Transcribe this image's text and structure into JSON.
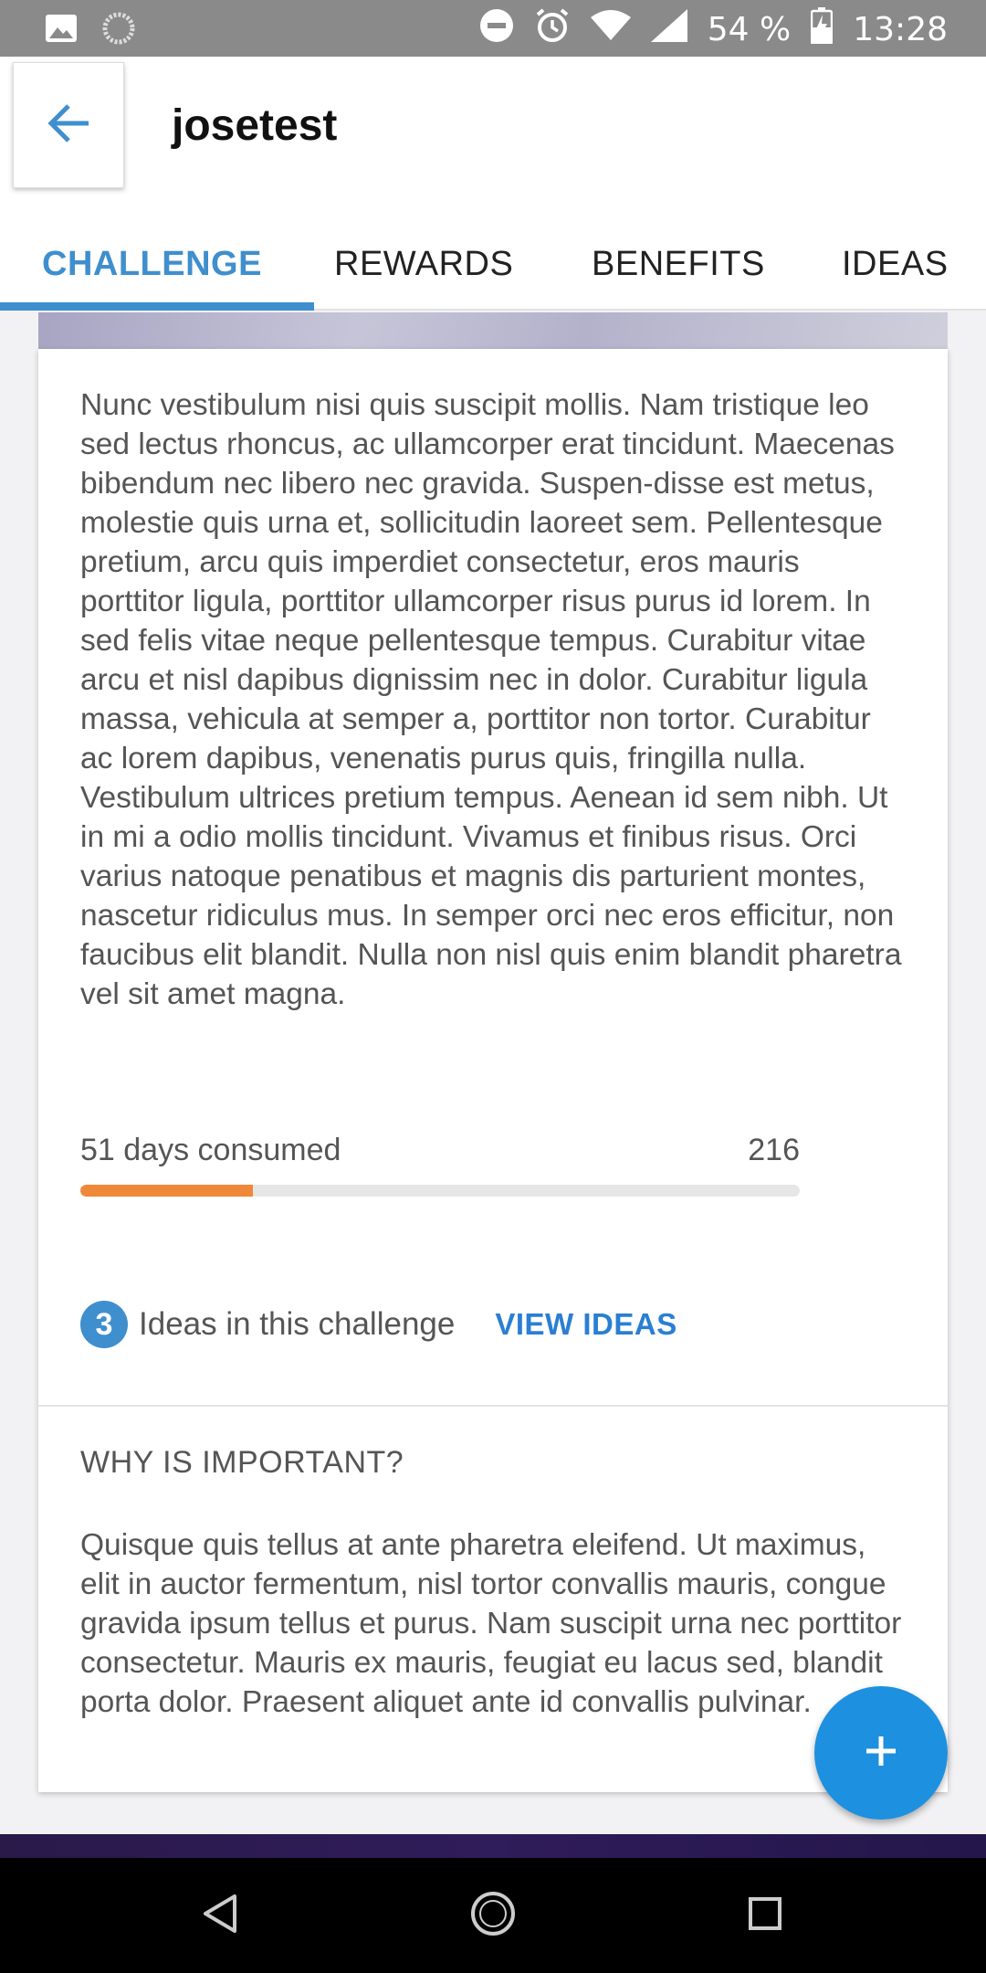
{
  "status_bar": {
    "battery": "54 %",
    "time": "13:28"
  },
  "app_bar": {
    "title": "josetest"
  },
  "tabs": [
    {
      "label": "CHALLENGE",
      "active": true
    },
    {
      "label": "REWARDS",
      "active": false
    },
    {
      "label": "BENEFITS",
      "active": false
    },
    {
      "label": "IDEAS",
      "active": false
    }
  ],
  "challenge": {
    "description": "Nunc vestibulum nisi quis suscipit mollis. Nam tristique leo sed lectus rhoncus, ac ullamcorper erat tincidunt. Maecenas bibendum nec libero nec gravida. Suspen-disse est metus, molestie quis urna et, sollicitudin laoreet sem. Pellentesque pretium, arcu quis imperdiet consectetur, eros mauris porttitor ligula, porttitor ullamcorper risus purus id lorem. In sed felis vitae neque pellentesque tempus. Curabitur vitae arcu et nisl dapibus dignissim nec in dolor. Curabitur ligula massa, vehicula at semper a, porttitor non tortor. Curabitur ac lorem dapibus, venenatis purus quis, fringilla nulla. Vestibulum ultrices pretium tempus. Aenean id sem nibh. Ut in mi a odio mollis tincidunt. Vivamus et finibus risus. Orci varius natoque penatibus et magnis dis parturient montes, nascetur ridiculus mus. In semper orci nec eros efficitur, non faucibus elit blandit. Nulla non nisl quis enim blandit pharetra vel sit amet magna.",
    "progress_label": "51 days consumed",
    "progress_total": "216",
    "progress_fraction": 0.24,
    "ideas_count": "3",
    "ideas_text": "Ideas in this challenge",
    "view_ideas_label": "VIEW IDEAS",
    "why_title": "WHY IS IMPORTANT?",
    "why_text": "Quisque quis tellus at ante pharetra eleifend. Ut maximus, elit in auctor fermentum, nisl tortor convallis mauris, congue gravida ipsum tellus et purus. Nam suscipit urna nec porttitor consectetur. Mauris ex mauris, feugiat eu lacus sed, blandit porta dolor. Praesent aliquet ante id convallis pulvinar."
  },
  "fab": {
    "icon": "plus-icon"
  },
  "colors": {
    "accent": "#3f8fce",
    "progress": "#f0883a",
    "fab": "#1e90e0",
    "link": "#2a7fd4"
  }
}
